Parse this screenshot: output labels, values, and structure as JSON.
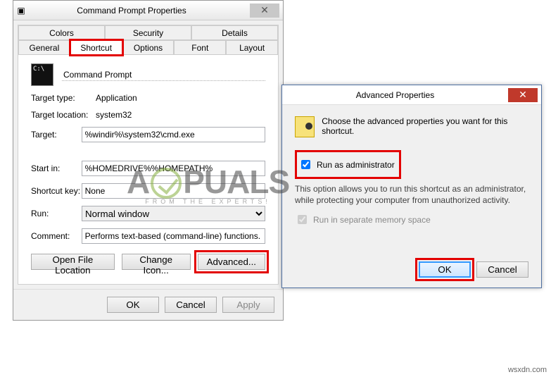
{
  "window1": {
    "title": "Command Prompt Properties",
    "tabs_row1": [
      "Colors",
      "Security",
      "Details"
    ],
    "tabs_row2": [
      "General",
      "Shortcut",
      "Options",
      "Font",
      "Layout"
    ],
    "active_tab": "Shortcut",
    "app_name": "Command Prompt",
    "target_type_label": "Target type:",
    "target_type": "Application",
    "target_location_label": "Target location:",
    "target_location": "system32",
    "target_label": "Target:",
    "target": "%windir%\\system32\\cmd.exe",
    "start_in_label": "Start in:",
    "start_in": "%HOMEDRIVE%%HOMEPATH%",
    "shortcut_key_label": "Shortcut key:",
    "shortcut_key": "None",
    "run_label": "Run:",
    "run": "Normal window",
    "comment_label": "Comment:",
    "comment": "Performs text-based (command-line) functions.",
    "open_file_location": "Open File Location",
    "change_icon": "Change Icon...",
    "advanced": "Advanced...",
    "ok": "OK",
    "cancel": "Cancel",
    "apply": "Apply"
  },
  "window2": {
    "title": "Advanced Properties",
    "description": "Choose the advanced properties you want for this shortcut.",
    "run_as_admin": "Run as administrator",
    "run_as_admin_desc": "This option allows you to run this shortcut as an administrator, while protecting your computer from unauthorized activity.",
    "run_separate": "Run in separate memory space",
    "ok": "OK",
    "cancel": "Cancel"
  },
  "watermark": {
    "brand_left": "A",
    "brand_right": "PUALS",
    "tagline": "FROM THE EXPERTS!"
  },
  "credit": "wsxdn.com"
}
